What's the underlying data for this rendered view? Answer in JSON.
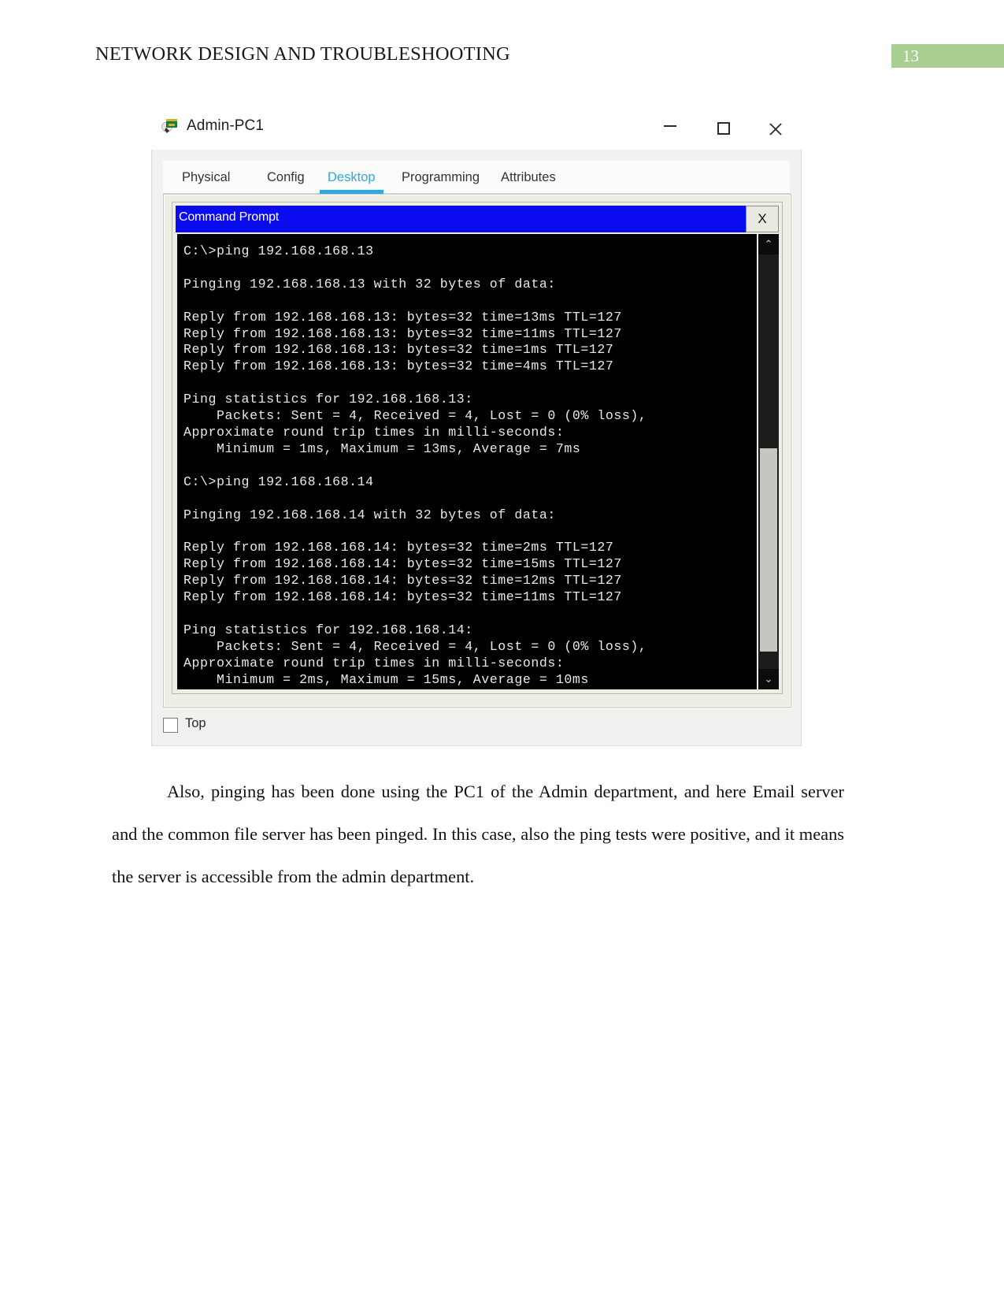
{
  "header": {
    "title": "NETWORK DESIGN AND TROUBLESHOOTING",
    "page_number": "13",
    "band_color": "#a8ce92"
  },
  "window": {
    "title": "Admin-PC1",
    "icon": "packet-tracer-pc-icon",
    "controls": {
      "minimize": "minimize-icon",
      "maximize": "maximize-icon",
      "close": "close-icon"
    }
  },
  "tabs": [
    {
      "label": "Physical",
      "active": false
    },
    {
      "label": "Config",
      "active": false
    },
    {
      "label": "Desktop",
      "active": true
    },
    {
      "label": "Programming",
      "active": false
    },
    {
      "label": "Attributes",
      "active": false
    }
  ],
  "tab_accent_color": "#29abe2",
  "command_prompt": {
    "title": "Command Prompt",
    "titlebar_color": "#0b0bf0",
    "close_label": "X",
    "scroll": {
      "up_arrow": "⌃",
      "down_arrow": "⌄"
    },
    "lines": [
      "C:\\>ping 192.168.168.13",
      "",
      "Pinging 192.168.168.13 with 32 bytes of data:",
      "",
      "Reply from 192.168.168.13: bytes=32 time=13ms TTL=127",
      "Reply from 192.168.168.13: bytes=32 time=11ms TTL=127",
      "Reply from 192.168.168.13: bytes=32 time=1ms TTL=127",
      "Reply from 192.168.168.13: bytes=32 time=4ms TTL=127",
      "",
      "Ping statistics for 192.168.168.13:",
      "    Packets: Sent = 4, Received = 4, Lost = 0 (0% loss),",
      "Approximate round trip times in milli-seconds:",
      "    Minimum = 1ms, Maximum = 13ms, Average = 7ms",
      "",
      "C:\\>ping 192.168.168.14",
      "",
      "Pinging 192.168.168.14 with 32 bytes of data:",
      "",
      "Reply from 192.168.168.14: bytes=32 time=2ms TTL=127",
      "Reply from 192.168.168.14: bytes=32 time=15ms TTL=127",
      "Reply from 192.168.168.14: bytes=32 time=12ms TTL=127",
      "Reply from 192.168.168.14: bytes=32 time=11ms TTL=127",
      "",
      "Ping statistics for 192.168.168.14:",
      "    Packets: Sent = 4, Received = 4, Lost = 0 (0% loss),",
      "Approximate round trip times in milli-seconds:",
      "    Minimum = 2ms, Maximum = 15ms, Average = 10ms"
    ]
  },
  "top_option": {
    "label": "Top",
    "checked": false
  },
  "paragraph": "Also, pinging has been done using the PC1 of the Admin department, and here Email server and the common file server has been pinged. In this case, also the ping tests were positive, and it means the server is accessible from the admin department."
}
